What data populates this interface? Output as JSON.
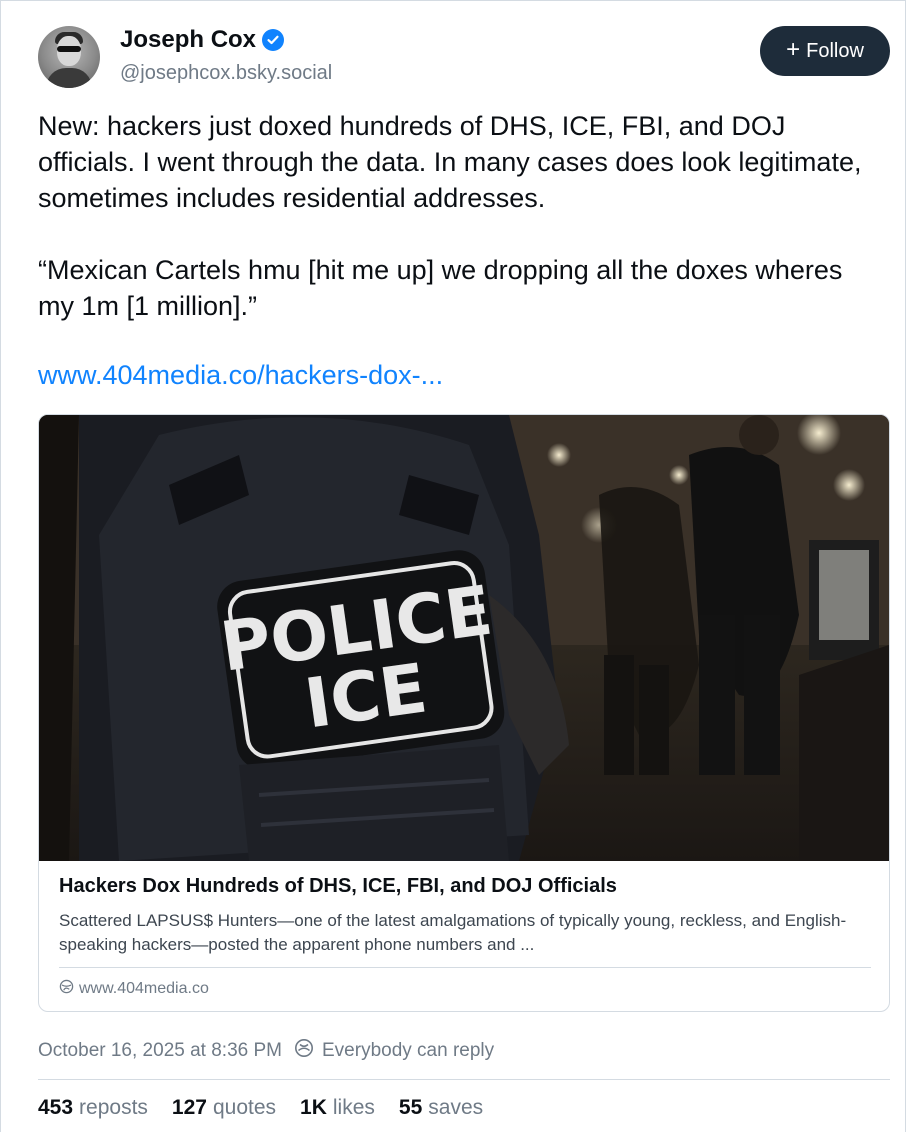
{
  "author": {
    "display_name": "Joseph Cox",
    "handle": "@josephcox.bsky.social",
    "verified": true
  },
  "follow_button": {
    "icon": "plus-icon",
    "label": "Follow"
  },
  "post": {
    "text": "New: hackers just doxed hundreds of DHS, ICE, FBI, and DOJ officials. I went through the data. In many cases does look legitimate, sometimes includes residential addresses.\n\n“Mexican Cartels hmu [hit me up] we dropping all the doxes wheres my 1m [1 million].”",
    "link": "www.404media.co/hackers-dox-..."
  },
  "link_card": {
    "image_patch_line1": "POLICE",
    "image_patch_line2": "ICE",
    "title": "Hackers Dox Hundreds of DHS, ICE, FBI, and DOJ Officials",
    "description": "Scattered LAPSUS$ Hunters—one of the latest amalgamations of typically young, reckless, and English-speaking hackers—posted the apparent phone numbers and ...",
    "domain_icon": "globe-icon",
    "domain": "www.404media.co"
  },
  "meta": {
    "timestamp": "October 16, 2025 at 8:36 PM",
    "reply_icon": "reply-settings-icon",
    "reply_setting": "Everybody can reply"
  },
  "stats": [
    {
      "count": "453",
      "label": "reposts"
    },
    {
      "count": "127",
      "label": "quotes"
    },
    {
      "count": "1K",
      "label": "likes"
    },
    {
      "count": "55",
      "label": "saves"
    }
  ],
  "colors": {
    "accent": "#1083fe",
    "follow_bg": "#1e2c3a",
    "muted_text": "#6f7a86",
    "border": "#d4dbe2"
  }
}
